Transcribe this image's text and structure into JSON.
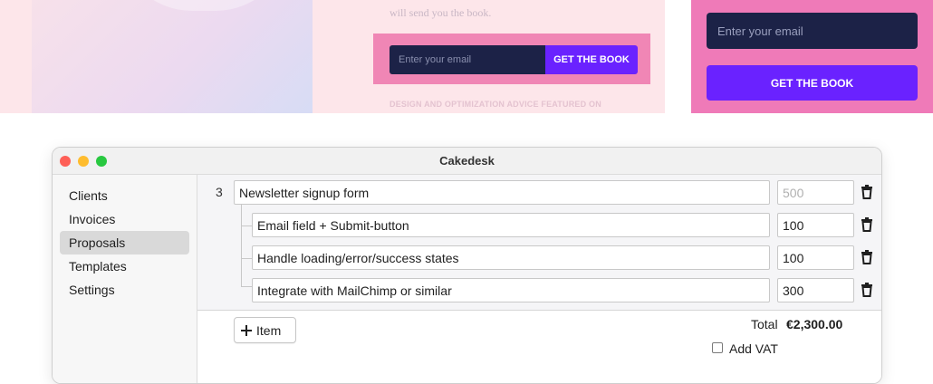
{
  "preview": {
    "left_text": "will send you the book.",
    "email_placeholder": "Enter your email",
    "cta_label": "GET THE BOOK",
    "featured_text": "DESIGN AND OPTIMIZATION ADVICE FEATURED ON",
    "right_email_placeholder": "Enter your email",
    "right_cta_label": "GET THE BOOK",
    "colors": {
      "pink_bg": "#fde6ea",
      "form_pink": "#ef7ab8",
      "navy": "#1c2247",
      "purple": "#6a22ff"
    }
  },
  "window": {
    "title": "Cakedesk"
  },
  "sidebar": {
    "items": [
      {
        "label": "Clients",
        "active": false
      },
      {
        "label": "Invoices",
        "active": false
      },
      {
        "label": "Proposals",
        "active": true
      },
      {
        "label": "Templates",
        "active": false
      },
      {
        "label": "Settings",
        "active": false
      }
    ]
  },
  "proposal": {
    "group": {
      "number": "3",
      "title": "Newsletter signup form",
      "amount_placeholder": "500"
    },
    "subitems": [
      {
        "title": "Email field + Submit-button",
        "amount": "100"
      },
      {
        "title": "Handle loading/error/success states",
        "amount": "100"
      },
      {
        "title": "Integrate with MailChimp or similar",
        "amount": "300"
      }
    ],
    "add_item_label": "Item",
    "total_label": "Total",
    "total_value": "€2,300.00",
    "vat_label": "Add VAT",
    "vat_checked": false
  }
}
